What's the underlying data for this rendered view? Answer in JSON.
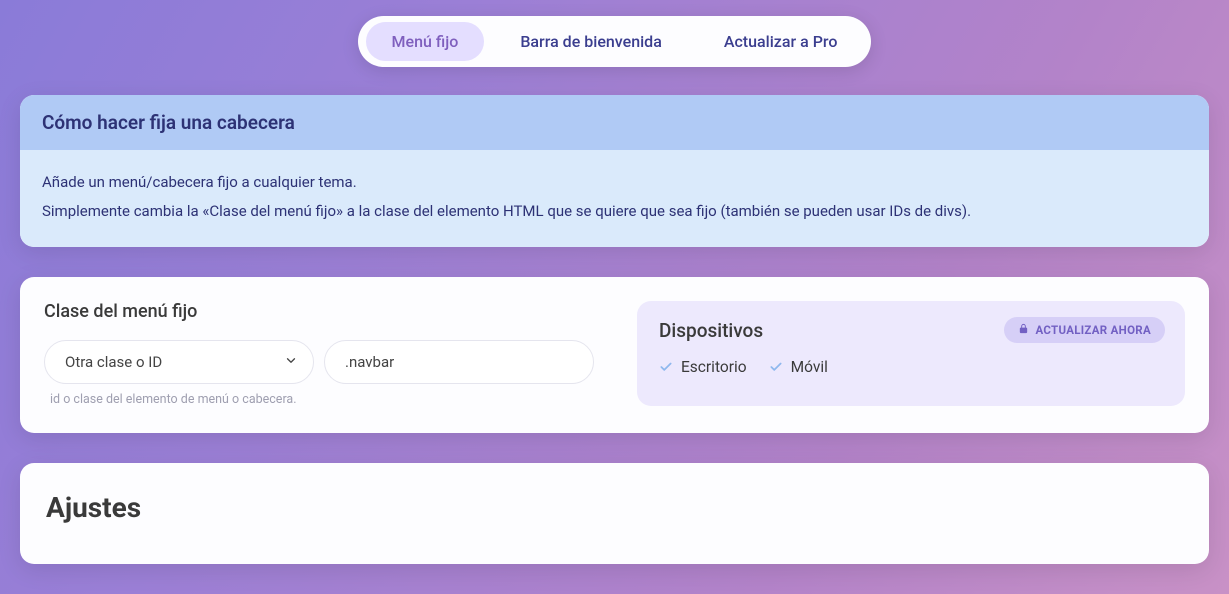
{
  "tabs": {
    "items": [
      {
        "label": "Menú fijo",
        "active": true
      },
      {
        "label": "Barra de bienvenida",
        "active": false
      },
      {
        "label": "Actualizar a Pro",
        "active": false
      }
    ]
  },
  "infobox": {
    "title": "Cómo hacer fija una cabecera",
    "line1": "Añade un menú/cabecera fijo a cualquier tema.",
    "line2": "Simplemente cambia la «Clase del menú fijo» a la clase del elemento HTML que se quiere que sea fijo (también se pueden usar IDs de divs)."
  },
  "sticky_class": {
    "label": "Clase del menú fijo",
    "select_value": "Otra clase o ID",
    "input_value": ".navbar",
    "helper": "id o clase del elemento de menú o cabecera."
  },
  "devices": {
    "title": "Dispositivos",
    "upgrade_label": "ACTUALIZAR AHORA",
    "items": [
      {
        "label": "Escritorio"
      },
      {
        "label": "Móvil"
      }
    ]
  },
  "settings": {
    "title": "Ajustes"
  }
}
